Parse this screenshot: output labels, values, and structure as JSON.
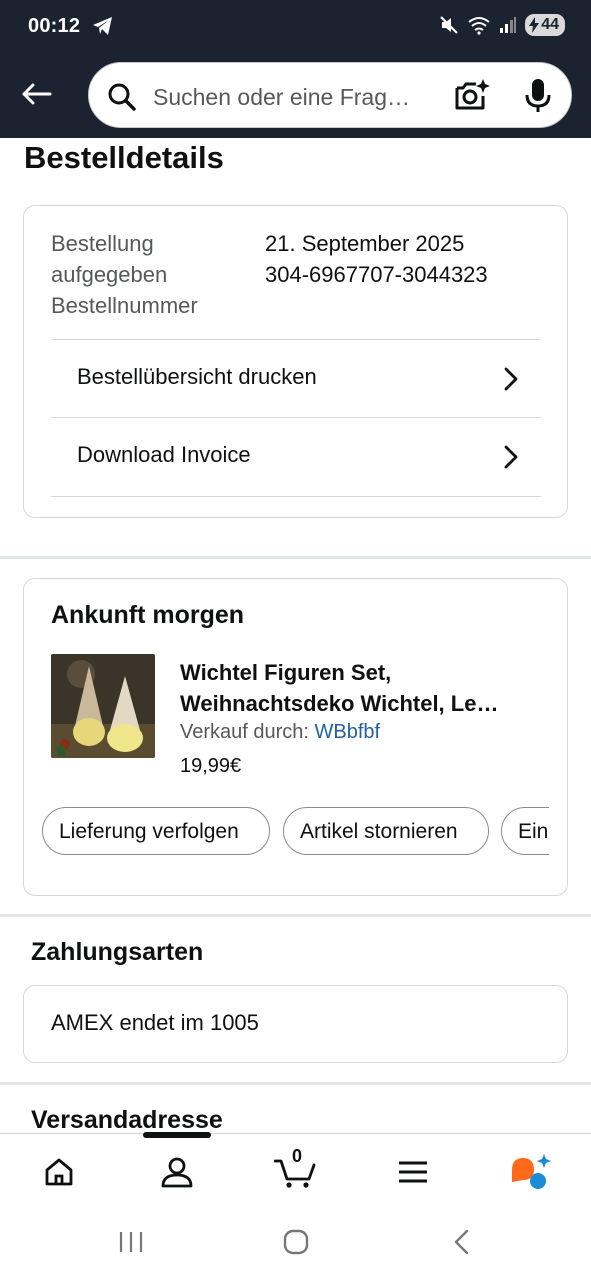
{
  "status_bar": {
    "time": "00:12",
    "battery": "44"
  },
  "header": {
    "search_placeholder": "Suchen oder eine Frag…"
  },
  "page": {
    "title": "Bestelldetails"
  },
  "order_info": {
    "labels": [
      "Bestellung",
      "aufgegeben",
      "Bestellnummer"
    ],
    "values": [
      "21. September 2025",
      "304-6967707-3044323"
    ],
    "actions": [
      "Bestellübersicht drucken",
      "Download Invoice"
    ]
  },
  "arrival": {
    "title": "Ankunft morgen",
    "product_title": "Wichtel Figuren Set, Weihnachtsdeko Wichtel, Le…",
    "seller_prefix": "Verkauf durch: ",
    "seller_name": "WBbfbf",
    "price": "19,99€",
    "chips": [
      "Lieferung verfolgen",
      "Artikel stornieren",
      "Ein"
    ]
  },
  "payment": {
    "title": "Zahlungsarten",
    "method": "AMEX endet im 1005"
  },
  "shipping": {
    "title": "Versandadresse"
  },
  "bottom_nav": {
    "cart_count": "0"
  },
  "colors": {
    "header_bg": "#1b2330",
    "link": "#2162a1",
    "border": "#d5d9d9",
    "separator": "#e3e6e6"
  }
}
